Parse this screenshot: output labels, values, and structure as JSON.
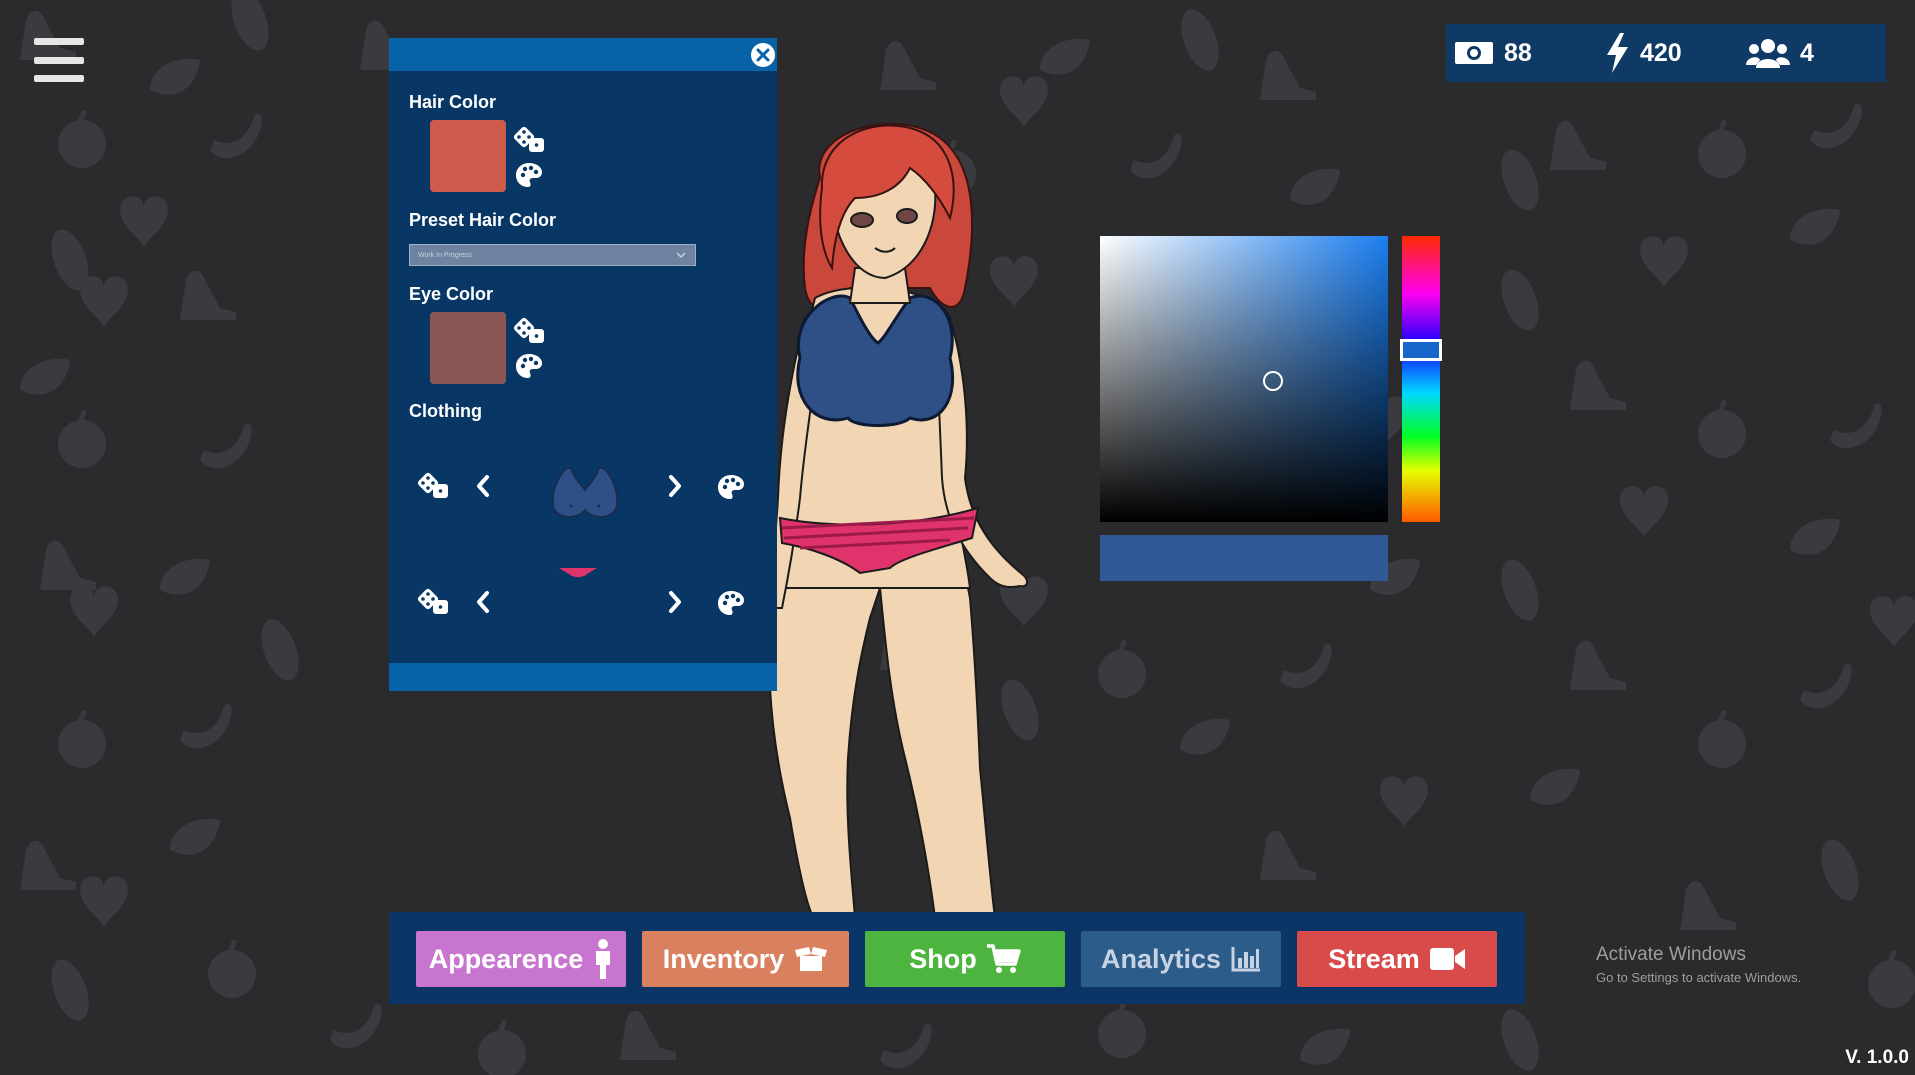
{
  "stats": {
    "money": "88",
    "energy": "420",
    "followers": "4"
  },
  "panel": {
    "hair_color_label": "Hair Color",
    "hair_color": "#cd5a4b",
    "preset_hair_label": "Preset Hair Color",
    "preset_hair_value": "Work In Progress",
    "eye_color_label": "Eye Color",
    "eye_color": "#8a5653",
    "clothing_label": "Clothing"
  },
  "color_picker": {
    "hue_color": "#1b7ef0",
    "selected_color": "#305a96"
  },
  "nav": {
    "appearance": {
      "label": "Appearence",
      "color": "#c775cf"
    },
    "inventory": {
      "label": "Inventory",
      "color": "#d9805f"
    },
    "shop": {
      "label": "Shop",
      "color": "#4db53f"
    },
    "analytics": {
      "label": "Analytics",
      "color": "#2c5c8a"
    },
    "stream": {
      "label": "Stream",
      "color": "#d94b4b"
    }
  },
  "watermark": {
    "title": "Activate Windows",
    "subtitle": "Go to Settings to activate Windows."
  },
  "version": "V. 1.0.0",
  "colors": {
    "background": "#2b2a2d",
    "panel": "#083766",
    "panel_header": "#0862a8",
    "top_clothing": "#2f4f87",
    "bottom_clothing": "#e0336b"
  },
  "icons": [
    "menu-icon",
    "money-icon",
    "lightning-icon",
    "users-icon",
    "close-icon",
    "dice-icon",
    "palette-icon",
    "chevron-left-icon",
    "chevron-right-icon",
    "person-icon",
    "box-icon",
    "cart-icon",
    "bar-chart-icon",
    "video-camera-icon"
  ]
}
